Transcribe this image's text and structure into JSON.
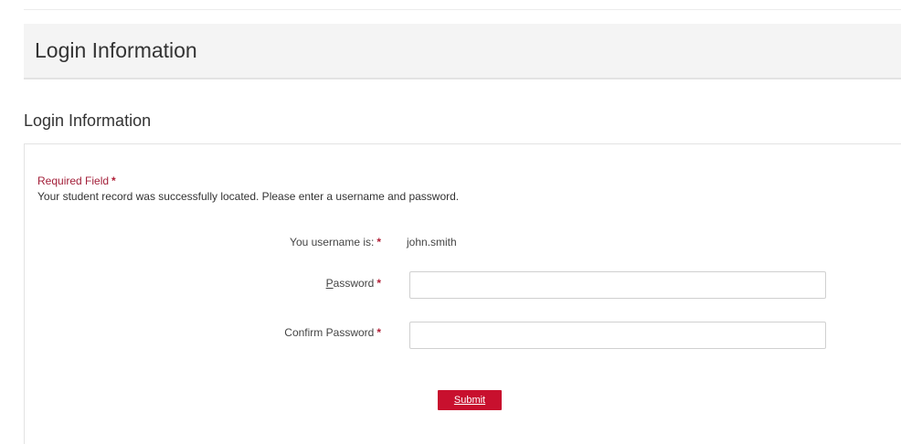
{
  "header": {
    "title": "Login Information"
  },
  "section": {
    "title": "Login Information"
  },
  "form": {
    "required_note": "Required Field",
    "required_marker": "*",
    "status_message": "Your student record was successfully located. Please enter a username and password.",
    "username_label": "You username is:",
    "username_value": "john.smith",
    "password_label_first": "P",
    "password_label_rest": "assword",
    "password_value": "",
    "confirm_label": "Confirm Password",
    "confirm_value": "",
    "submit_label": "Submit"
  },
  "colors": {
    "accent": "#c8102e",
    "required": "#a3203a",
    "header_bg": "#f4f4f4"
  }
}
